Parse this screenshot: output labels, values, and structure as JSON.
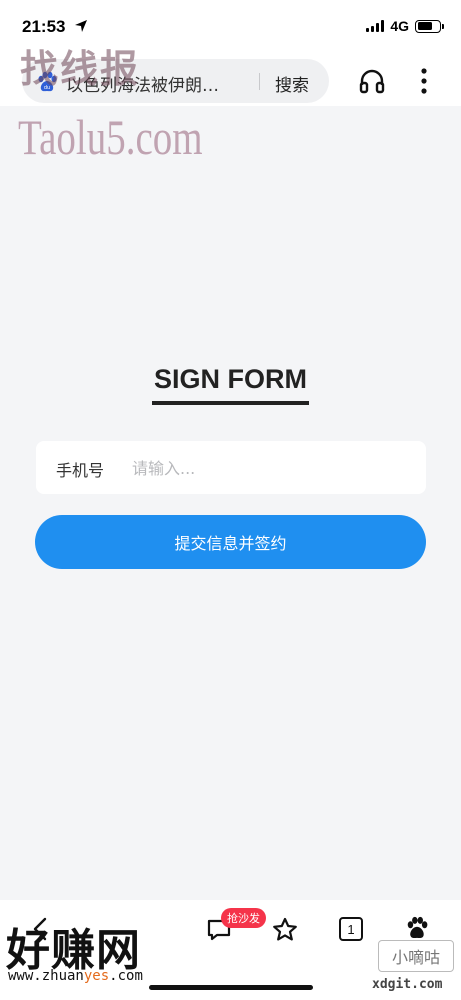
{
  "status_bar": {
    "time": "21:53",
    "network": "4G",
    "battery_level": 0.7
  },
  "browser": {
    "address_text": "以色列海法被伊朗…",
    "search_label": "搜索"
  },
  "watermarks": {
    "top_left": "找线报",
    "taolu": "Taolu5.com",
    "bottom_left": "好赚网",
    "bottom_left_url_prefix": "www.zhuan",
    "bottom_left_url_accent": "yes",
    "bottom_left_url_suffix": ".com",
    "right_box": "小嘀咕",
    "right_url": "xdgit.com"
  },
  "form": {
    "title": "SIGN FORM",
    "phone_label": "手机号",
    "phone_placeholder": "请输入...",
    "phone_value": "",
    "submit_label": "提交信息并签约"
  },
  "bottom_nav": {
    "comment_badge": "抢沙发",
    "tab_count": "1"
  },
  "colors": {
    "accent": "#1f8ff0",
    "badge": "#f5344a",
    "page_bg": "#f4f5f7"
  }
}
